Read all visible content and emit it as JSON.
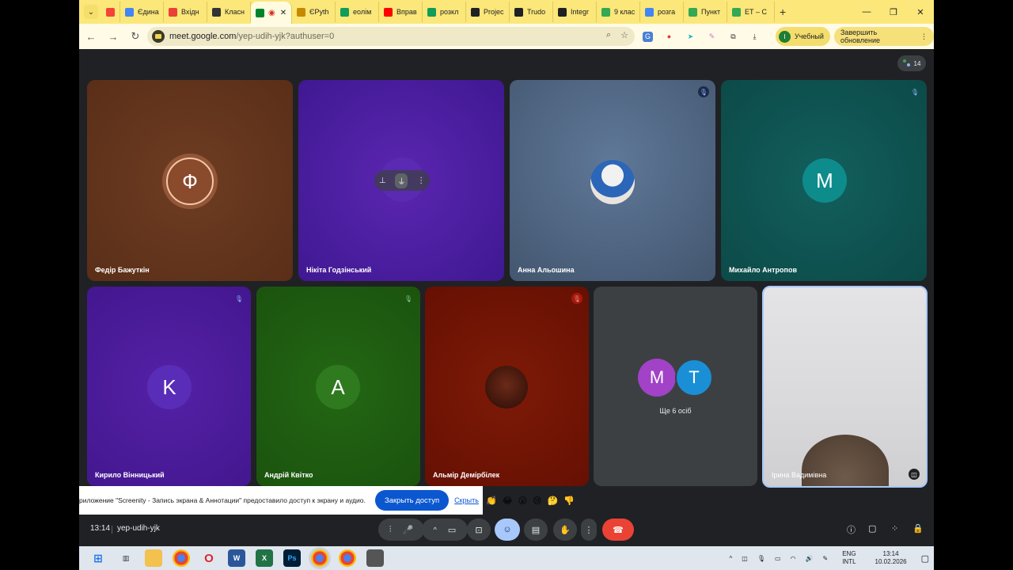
{
  "browser": {
    "tabs": [
      {
        "label": "",
        "fav": "#f44336",
        "fav_icon": "record-icon"
      },
      {
        "label": "Єдина",
        "fav": "#4285f4",
        "fav_icon": "doc-icon"
      },
      {
        "label": "Вхідн",
        "fav": "#ea4335",
        "fav_icon": "gmail-icon"
      },
      {
        "label": "Класн",
        "fav": "#333333",
        "fav_icon": "classroom-icon"
      },
      {
        "label": "",
        "fav": "#00832d",
        "fav_icon": "meet-icon",
        "active": true
      },
      {
        "label": "ЄPyth",
        "fav": "#c58a00",
        "fav_icon": "euro-icon"
      },
      {
        "label": "еолім",
        "fav": "#0f9d58",
        "fav_icon": "sheets-icon"
      },
      {
        "label": "Вправ",
        "fav": "#ff0000",
        "fav_icon": "youtube-icon"
      },
      {
        "label": "розкл",
        "fav": "#0f9d58",
        "fav_icon": "sheets-icon"
      },
      {
        "label": "Projec",
        "fav": "#202124",
        "fav_icon": "circle-icon"
      },
      {
        "label": "Trudo",
        "fav": "#202124",
        "fav_icon": "circle-icon"
      },
      {
        "label": "Integr",
        "fav": "#202124",
        "fav_icon": "circle-icon"
      },
      {
        "label": "9 клас",
        "fav": "#34a853",
        "fav_icon": "drive-icon"
      },
      {
        "label": "розга",
        "fav": "#4285f4",
        "fav_icon": "docs-icon"
      },
      {
        "label": "Пункт",
        "fav": "#34a853",
        "fav_icon": "drive-icon"
      },
      {
        "label": "ЕТ – С",
        "fav": "#34a853",
        "fav_icon": "drive-icon"
      }
    ],
    "url_host": "meet.google.com",
    "url_path": "/yep-udih-yjk?authuser=0",
    "profile_initial": "I",
    "profile_label": "Учебный",
    "update_label": "Завершить обновление"
  },
  "meet": {
    "participant_count": "14",
    "tiles": [
      {
        "name": "Федір Бажуткін",
        "initial": "Ф",
        "bg": "#6b3a1f"
      },
      {
        "name": "Нікіта Годзінський",
        "initial": "",
        "bg": "#4a1fa0"
      },
      {
        "name": "Анна Альошина",
        "initial": "",
        "bg": "#4e6480"
      },
      {
        "name": "Михайло Антропов",
        "initial": "M",
        "bg": "#0f5a58",
        "avatar_bg": "#0e8c8c"
      },
      {
        "name": "Кирило Вінницький",
        "initial": "K",
        "bg": "#4e1f9a",
        "avatar_bg": "#5a2db8"
      },
      {
        "name": "Андрій Квітко",
        "initial": "A",
        "bg": "#1e5a12",
        "avatar_bg": "#2f7a1f"
      },
      {
        "name": "Альмір Демірбілек",
        "initial": "",
        "bg": "#7a1505"
      },
      {
        "name": "",
        "initial": "",
        "bg": "#3c4043"
      },
      {
        "name": "Ірина Вадимівна",
        "initial": "",
        "bg": "#d6d6d6"
      }
    ],
    "more_people": "Ще 6 осіб",
    "more_initials": [
      "M",
      "T"
    ],
    "banner_text": "риложение \"Screenity - Запись экрана & Аннотации\" предоставило доступ к экрану и аудио.",
    "banner_stop": "Закрыть доступ",
    "banner_hide": "Скрыть",
    "reactions": [
      "👏",
      "😂",
      "😮",
      "😢",
      "🤔",
      "👎"
    ],
    "time": "13:14",
    "meeting_code": "yep-udih-yjk"
  },
  "taskbar": {
    "lang_top": "ENG",
    "lang_bottom": "INTL",
    "clock_time": "13:14",
    "clock_date": "10.02.2026"
  }
}
